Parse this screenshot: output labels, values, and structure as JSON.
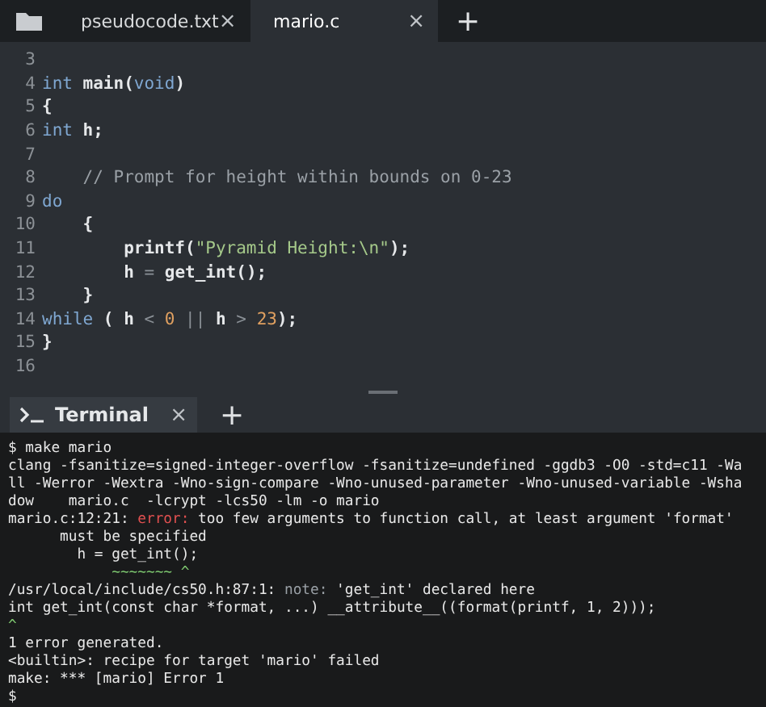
{
  "editor_tabs": [
    {
      "label": "pseudocode.txt",
      "close": "×",
      "selected": false
    },
    {
      "label": "mario.c",
      "close": "×",
      "selected": true
    }
  ],
  "new_tab": "+",
  "code_lines": [
    {
      "number": "3"
    },
    {
      "number": "4",
      "segments": [
        {
          "kind": "keyword",
          "text": "int"
        },
        {
          "kind": "plain",
          "text": " main("
        },
        {
          "kind": "keyword",
          "text": "void"
        },
        {
          "kind": "plain",
          "text": ")"
        }
      ]
    },
    {
      "number": "5",
      "segments": [
        {
          "kind": "plain",
          "text": "{"
        }
      ]
    },
    {
      "number": "6",
      "segments": [
        {
          "kind": "keyword",
          "text": "int"
        },
        {
          "kind": "plain",
          "text": " h;"
        }
      ]
    },
    {
      "number": "7"
    },
    {
      "number": "8",
      "segments": [
        {
          "kind": "comment",
          "text": "    // Prompt for height within bounds on 0-23"
        }
      ]
    },
    {
      "number": "9",
      "segments": [
        {
          "kind": "keyword",
          "text": "do"
        }
      ]
    },
    {
      "number": "10",
      "segments": [
        {
          "kind": "plain",
          "text": "    {"
        }
      ]
    },
    {
      "number": "11",
      "segments": [
        {
          "kind": "plain",
          "text": "        printf("
        },
        {
          "kind": "string",
          "text": "\"Pyramid Height:\\n\""
        },
        {
          "kind": "plain",
          "text": ");"
        }
      ]
    },
    {
      "number": "12",
      "segments": [
        {
          "kind": "plain",
          "text": "        h "
        },
        {
          "kind": "operator",
          "text": "="
        },
        {
          "kind": "plain",
          "text": " get_int();"
        }
      ]
    },
    {
      "number": "13",
      "segments": [
        {
          "kind": "plain",
          "text": "    }"
        }
      ]
    },
    {
      "number": "14",
      "segments": [
        {
          "kind": "keyword",
          "text": "while"
        },
        {
          "kind": "plain",
          "text": " ( h "
        },
        {
          "kind": "operator",
          "text": "< "
        },
        {
          "kind": "number",
          "text": "0"
        },
        {
          "kind": "operator",
          "text": " || "
        },
        {
          "kind": "plain",
          "text": "h "
        },
        {
          "kind": "operator",
          "text": "> "
        },
        {
          "kind": "number",
          "text": "23"
        },
        {
          "kind": "plain",
          "text": ");"
        }
      ]
    },
    {
      "number": "15",
      "segments": [
        {
          "kind": "plain",
          "text": "}"
        }
      ]
    },
    {
      "number": "16"
    }
  ],
  "terminal_tab": {
    "label": "Terminal",
    "close": "×",
    "selected": true
  },
  "new_terminal": "+",
  "terminal_lines": [
    [
      {
        "kind": "plain",
        "text": "$ make mario"
      }
    ],
    [
      {
        "kind": "plain",
        "text": "clang -fsanitize=signed-integer-overflow -fsanitize=undefined -ggdb3 -O0 -std=c11 -Wa"
      }
    ],
    [
      {
        "kind": "plain",
        "text": "ll -Werror -Wextra -Wno-sign-compare -Wno-unused-parameter -Wno-unused-variable -Wsha"
      }
    ],
    [
      {
        "kind": "plain",
        "text": "dow    mario.c  -lcrypt -lcs50 -lm -o mario"
      }
    ],
    [
      {
        "kind": "plain",
        "text": "mario.c:12:21: "
      },
      {
        "kind": "error",
        "text": "error:"
      },
      {
        "kind": "plain",
        "text": " too few arguments to function call, at least argument 'format'"
      }
    ],
    [
      {
        "kind": "plain",
        "text": "      must be specified"
      }
    ],
    [
      {
        "kind": "plain",
        "text": "        h = get_int();"
      }
    ],
    [
      {
        "kind": "caret",
        "text": "            ~~~~~~~ ^"
      }
    ],
    [
      {
        "kind": "plain",
        "text": "/usr/local/include/cs50.h:87:1: "
      },
      {
        "kind": "note",
        "text": "note:"
      },
      {
        "kind": "plain",
        "text": " 'get_int' declared here"
      }
    ],
    [
      {
        "kind": "plain",
        "text": "int get_int(const char *format, ...) __attribute__((format(printf, 1, 2)));"
      }
    ],
    [
      {
        "kind": "caret",
        "text": "^"
      }
    ],
    [
      {
        "kind": "plain",
        "text": "1 error generated."
      }
    ],
    [
      {
        "kind": "plain",
        "text": "<builtin>: recipe for target 'mario' failed"
      }
    ],
    [
      {
        "kind": "plain",
        "text": "make: *** [mario] Error 1"
      }
    ],
    [
      {
        "kind": "plain",
        "text": "$"
      }
    ]
  ]
}
